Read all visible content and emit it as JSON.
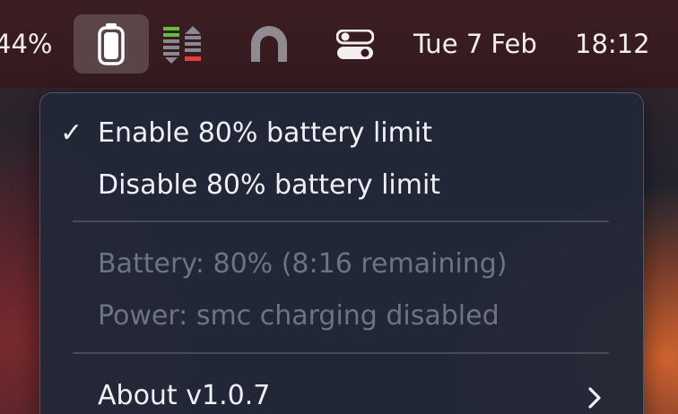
{
  "menubar": {
    "battery_percent": "44%",
    "date": "Tue 7 Feb",
    "time": "18:12",
    "icons": [
      "battery-icon",
      "stats-icon",
      "arch-icon",
      "control-center-icon"
    ]
  },
  "menu": {
    "items": [
      {
        "label": "Enable 80% battery limit",
        "checked": true,
        "enabled": true
      },
      {
        "label": "Disable 80% battery limit",
        "checked": false,
        "enabled": true
      },
      {
        "label": "Battery: 80% (8:16 remaining)",
        "enabled": false
      },
      {
        "label": "Power: smc charging disabled",
        "enabled": false
      },
      {
        "label": "About v1.0.7",
        "enabled": true,
        "submenu": true
      }
    ],
    "check_glyph": "✓"
  },
  "colors": {
    "menubar_bg": "#351b20",
    "menu_bg": "#222838",
    "text": "#f0f1f4",
    "disabled_text": "#6d7383",
    "stats_green": "#5fbf3f",
    "stats_red": "#e0413a"
  }
}
